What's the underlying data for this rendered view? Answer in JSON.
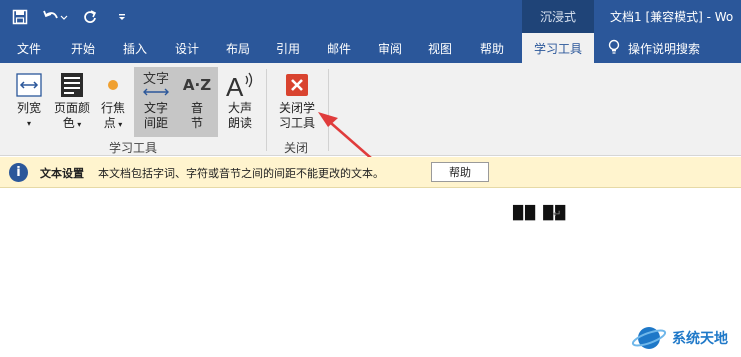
{
  "titlebar": {
    "immersive_label": "沉浸式",
    "document_title": "文档1 [兼容模式] - Wo"
  },
  "tabs": [
    {
      "label": "文件"
    },
    {
      "label": "开始"
    },
    {
      "label": "插入"
    },
    {
      "label": "设计"
    },
    {
      "label": "布局"
    },
    {
      "label": "引用"
    },
    {
      "label": "邮件"
    },
    {
      "label": "审阅"
    },
    {
      "label": "视图"
    },
    {
      "label": "帮助"
    },
    {
      "label": "学习工具"
    }
  ],
  "active_tab": "学习工具",
  "tell_me": "操作说明搜索",
  "ribbon": {
    "learning_tools": {
      "column_width_line1": "列宽",
      "page_color_line1": "页面颜",
      "page_color_line2": "色",
      "line_focus_line1": "行焦",
      "line_focus_line2": "点",
      "text_spacing_icon": "文字",
      "text_spacing_line1": "文字",
      "text_spacing_line2": "间距",
      "syllables_icon": "A·Z",
      "syllables_line1": "音",
      "syllables_line2": "节",
      "read_aloud_line1": "大声",
      "read_aloud_line2": "朗读",
      "group_label": "学习工具"
    },
    "close": {
      "close_line1": "关闭学",
      "close_line2": "习工具",
      "group_label": "关闭"
    }
  },
  "infobar": {
    "title": "文本设置",
    "message": "本文档包括字词、字符或音节之间的间距不能更改的文本。",
    "help_button": "帮助"
  },
  "document": {
    "text": "██ ██"
  },
  "watermark": {
    "text": "系统天地"
  },
  "colors": {
    "brand_blue": "#2b579a",
    "ribbon_bg": "#f1f1f1",
    "infobar_bg": "#fff4ce",
    "close_red": "#d9432f",
    "arrow_red": "#e03c3c"
  }
}
